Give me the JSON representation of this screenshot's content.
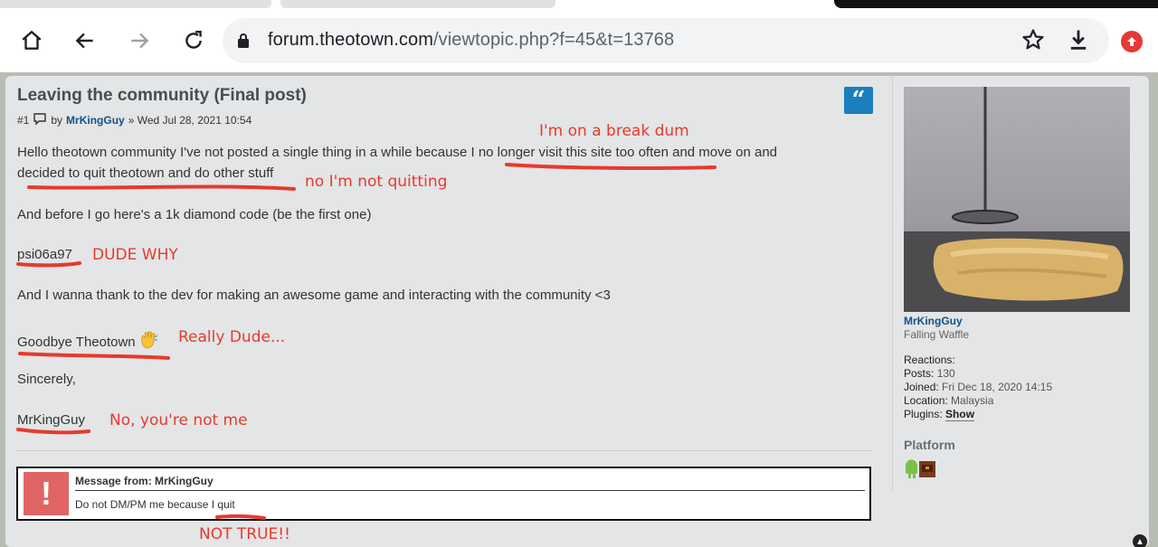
{
  "browser": {
    "url_host": "forum.theotown.com",
    "url_path": "/viewtopic.php?f=45&t=13768",
    "icons": [
      "home-icon",
      "back-icon",
      "forward-icon",
      "reload-icon",
      "lock-icon",
      "star-icon",
      "download-icon",
      "extension-icon"
    ]
  },
  "post": {
    "title": "Leaving the community (Final post)",
    "number": "#1",
    "by": "by",
    "author": "MrKingGuy",
    "date": "» Wed Jul 28, 2021 10:54",
    "line1": "Hello theotown community I've not posted a single thing in a while because I no longer visit this site too often and move on and",
    "line2": "decided to quit theotown and do other stuff",
    "line3": "And before I go here's a 1k diamond code (be the first one)",
    "code": "psi06a97",
    "line4": "And I wanna thank to the dev for making an awesome game and interacting with the community <3",
    "goodbye": "Goodbye Theotown",
    "sincerely": "Sincerely,",
    "signature": "MrKingGuy",
    "notice_from": "Message from: MrKingGuy",
    "notice_msg": "Do not DM/PM me because I quit",
    "notice_icon": "!"
  },
  "profile": {
    "name": "MrKingGuy",
    "rank": "Falling Waffle",
    "reactions_label": "Reactions:",
    "posts_label": "Posts:",
    "posts": "130",
    "joined_label": "Joined:",
    "joined": "Fri Dec 18, 2020 14:15",
    "location_label": "Location:",
    "location": "Malaysia",
    "plugins_label": "Plugins:",
    "plugins_link": "Show",
    "platform": "Platform"
  },
  "annotations": {
    "break": "I'm on a break dum",
    "not_quitting": "no I'm not quitting",
    "dude_why": "DUDE WHY",
    "really": "Really Dude...",
    "not_me": "No, you're not me",
    "not_true": "NOT TRUE!!",
    "color": "#e8392e"
  }
}
